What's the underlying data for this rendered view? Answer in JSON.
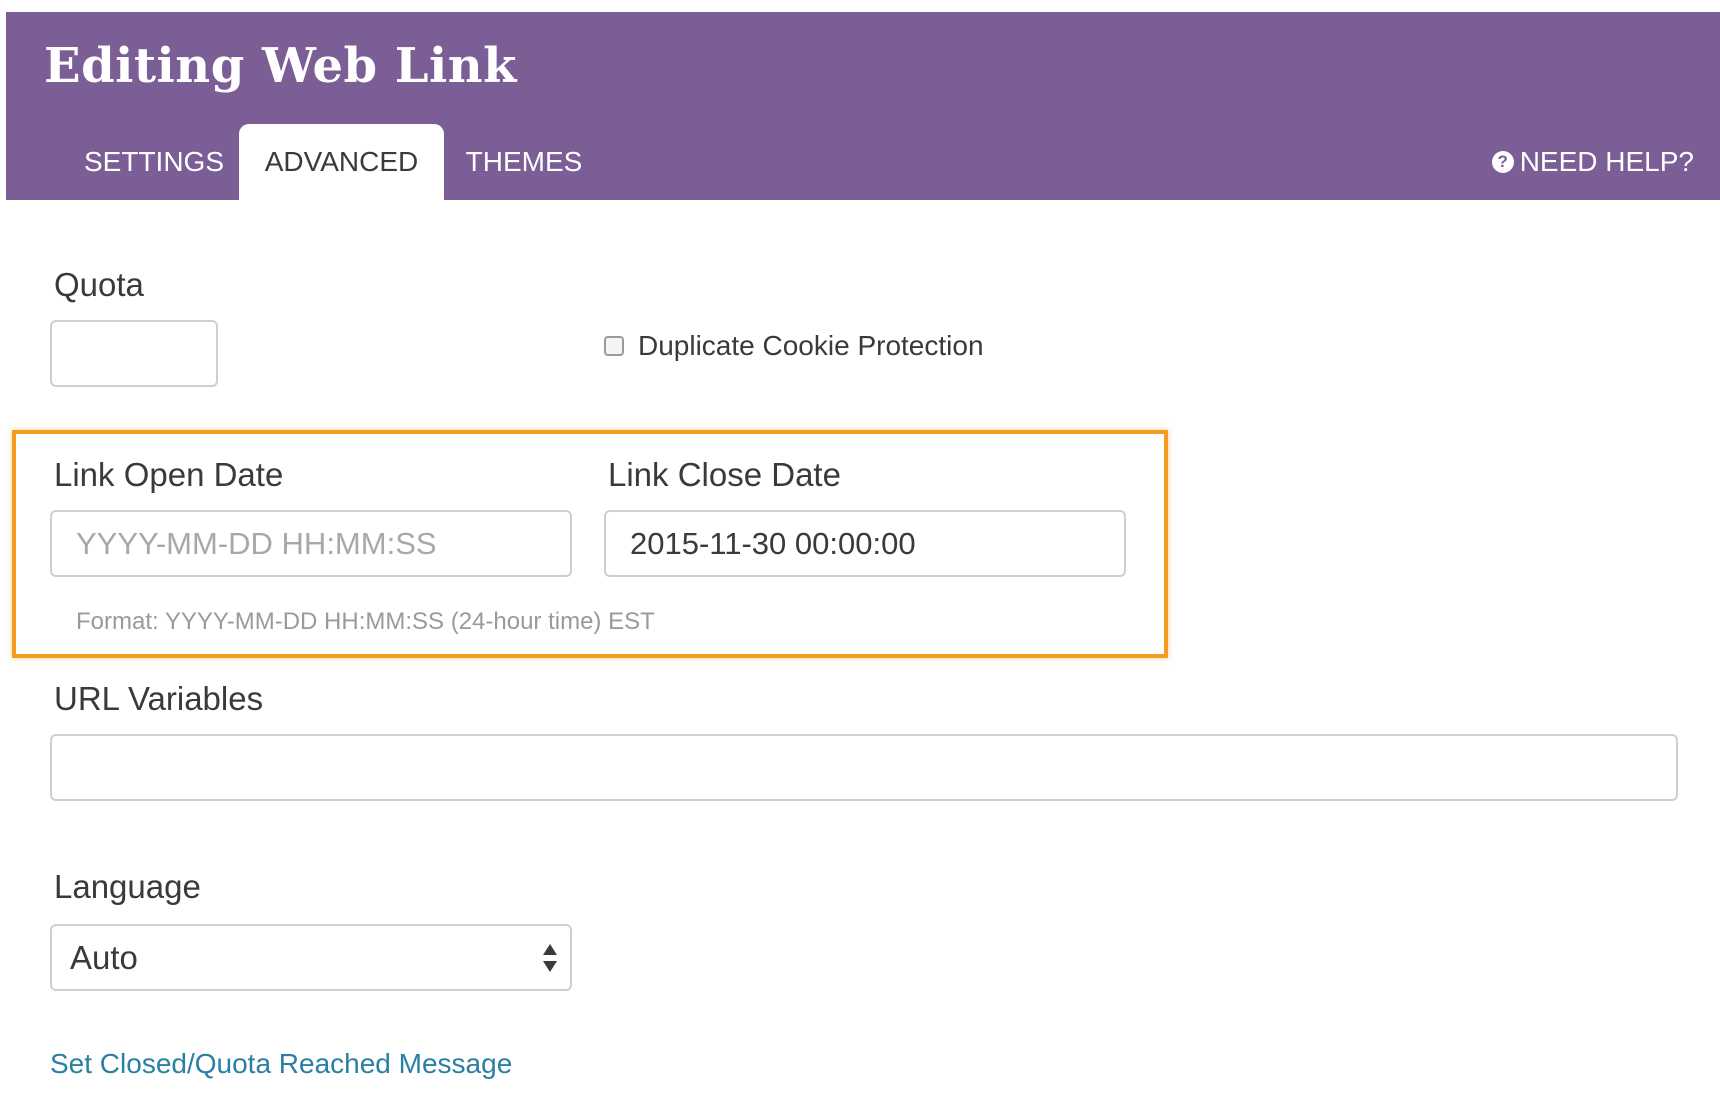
{
  "header": {
    "title": "Editing Web Link",
    "tabs": [
      {
        "label": "SETTINGS"
      },
      {
        "label": "ADVANCED"
      },
      {
        "label": "THEMES"
      }
    ],
    "help_label": "NEED HELP?"
  },
  "colors": {
    "header_bg": "#7b5e96",
    "highlight": "#f39c1f",
    "link": "#2b7fa3"
  },
  "quota": {
    "label": "Quota",
    "value": ""
  },
  "duplicate_cookie": {
    "label": "Duplicate Cookie Protection",
    "checked": false
  },
  "open_date": {
    "label": "Link Open Date",
    "value": "",
    "placeholder": "YYYY-MM-DD HH:MM:SS"
  },
  "close_date": {
    "label": "Link Close Date",
    "value": "2015-11-30 00:00:00"
  },
  "date_hint": "Format: YYYY-MM-DD HH:MM:SS (24-hour time) EST",
  "url_variables": {
    "label": "URL Variables",
    "value": ""
  },
  "language": {
    "label": "Language",
    "selected": "Auto"
  },
  "closed_message_link": "Set Closed/Quota Reached Message"
}
